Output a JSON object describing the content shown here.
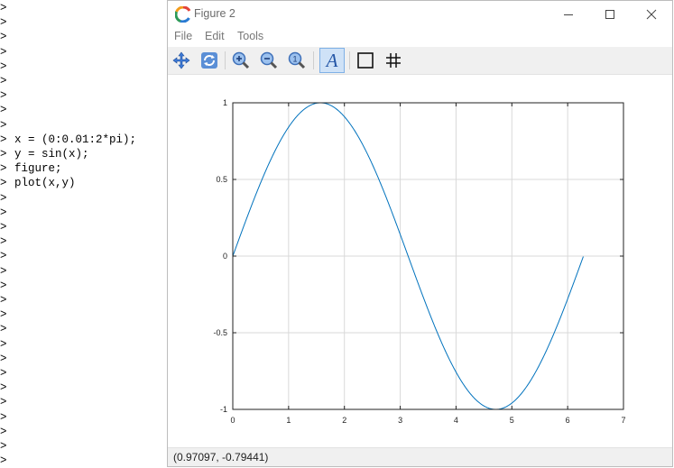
{
  "console": {
    "prompt": ">",
    "command_start_line": 9,
    "total_lines": 32,
    "commands": [
      "x = (0:0.01:2*pi);",
      "y = sin(x);",
      "figure;",
      "plot(x,y)"
    ]
  },
  "window": {
    "title": "Figure 2",
    "controls": {
      "minimize": "—",
      "maximize": "☐",
      "close": "✕"
    }
  },
  "menu": {
    "items": [
      "File",
      "Edit",
      "Tools"
    ]
  },
  "toolbar": {
    "buttons": [
      {
        "name": "pan-tool-button",
        "icon": "pan-arrows-icon"
      },
      {
        "name": "rotate-tool-button",
        "icon": "rotate-icon"
      },
      {
        "name": "zoom-in-button",
        "icon": "zoom-in-icon"
      },
      {
        "name": "zoom-out-button",
        "icon": "zoom-out-icon"
      },
      {
        "name": "zoom-reset-button",
        "icon": "zoom-original-icon"
      },
      {
        "name": "insert-text-button",
        "icon": "text-A-icon"
      },
      {
        "name": "toggle-box-button",
        "icon": "box-icon"
      },
      {
        "name": "toggle-grid-button",
        "icon": "grid-icon"
      }
    ],
    "text_button_label": "A"
  },
  "status": {
    "coordinates": "(0.97097, -0.79441)"
  },
  "colors": {
    "line": "#0072bd",
    "grid": "#d9d9d9",
    "icon_blue": "#3d7ad8"
  },
  "chart_data": {
    "type": "line",
    "title": "",
    "xlabel": "",
    "ylabel": "",
    "xlim": [
      0,
      7
    ],
    "ylim": [
      -1,
      1
    ],
    "xticks": [
      0,
      1,
      2,
      3,
      4,
      5,
      6,
      7
    ],
    "yticks": [
      -1,
      -0.5,
      0,
      0.5,
      1
    ],
    "grid": true,
    "series": [
      {
        "function": "y = sin(x)",
        "x_start": 0,
        "x_end": 6.28,
        "x_step": 0.01
      }
    ]
  }
}
